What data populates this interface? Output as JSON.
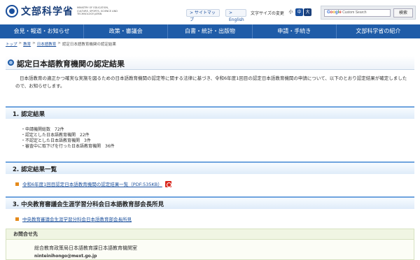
{
  "header": {
    "logo_text": "文部科学省",
    "logo_en": "MINISTRY OF EDUCATION, CULTURE, SPORTS, SCIENCE AND TECHNOLOGY-JAPAN",
    "sitemap_label": "> サイトマップ",
    "english_label": "> English",
    "font_size_label": "文字サイズの変更",
    "font_small": "小",
    "font_medium": "中",
    "font_large": "大",
    "search_placeholder": "Custom Search",
    "search_button": "検索"
  },
  "nav": {
    "items": [
      "会見・報道・お知らせ",
      "政策・審議会",
      "白書・統計・出版物",
      "申請・手続き",
      "文部科学省の紹介"
    ]
  },
  "breadcrumb": {
    "items": [
      "トップ",
      "教育",
      "日本語教育"
    ],
    "current": "認定日本語教育機関の認定結果"
  },
  "main": {
    "title": "認定日本語教育機関の認定結果",
    "intro": "日本語教育の適正かつ確実な実施を図るための日本語教育機関の認定等に関する法律に基づき、令和6年度1回目の認定日本語教育機関の申請について、以下のとおり認定結果が確定しましたので、お知らせします。"
  },
  "sections": [
    {
      "heading": "1. 認定結果"
    },
    {
      "heading": "2. 認定結果一覧"
    },
    {
      "heading": "3. 中央教育審議会生涯学習分科会日本語教育部会長所見"
    }
  ],
  "results": [
    "・申請機関総数　72件",
    "・認定とした日本語教育機関　22件",
    "・不認定とした日本語教育機関　3件",
    "・審査中に取下げを行った日本語教育機関　36件"
  ],
  "links": {
    "list_link": "令和6年度1回目認定日本語教育機関の認定結果一覧（PDF:535KB）",
    "opinion_link": "中央教育審議会生涯学習分科会日本語教育部会長所見"
  },
  "contact": {
    "heading": "お問合せ先",
    "org": "総合教育政策局日本語教育課日本語教育機関室",
    "email": "ninteinihongo@mext.go.jp"
  },
  "colors": {
    "nav_bg": "#1f5ca8",
    "section_border": "#6ea3de",
    "link": "#1a4f9c",
    "bullet": "#e48a1b",
    "pdf": "#d9261c"
  }
}
